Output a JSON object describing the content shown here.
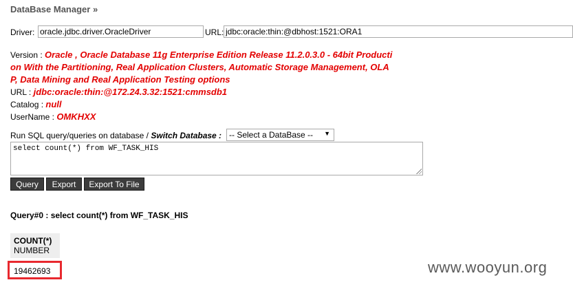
{
  "header": {
    "title": "DataBase Manager »"
  },
  "connection": {
    "driver_label": "Driver:",
    "driver_value": "oracle.jdbc.driver.OracleDriver",
    "url_label": "URL:",
    "url_value": "jdbc:oracle:thin:@dbhost:1521:ORA1"
  },
  "info": {
    "version_label": "Version :",
    "version_line1": "Oracle , Oracle Database 11g Enterprise Edition Release 11.2.0.3.0 - 64bit Producti",
    "version_line2": "on With the Partitioning, Real Application Clusters, Automatic Storage Management, OLA",
    "version_line3": "P, Data Mining and Real Application Testing options",
    "url_label": "URL :",
    "url_value": "jdbc:oracle:thin:@172.24.3.32:1521:cmmsdb1",
    "catalog_label": "Catalog :",
    "catalog_value": "null",
    "username_label": "UserName :",
    "username_value": "OMKHXX"
  },
  "sql": {
    "run_label": "Run SQL query/queries on database / ",
    "switch_label": "Switch Database :",
    "select_value": "-- Select a DataBase --",
    "query_text": "select count(*) from WF_TASK_HIS"
  },
  "buttons": {
    "query": "Query",
    "export": "Export",
    "export_file": "Export To File"
  },
  "result": {
    "heading": "Query#0 : select count(*) from WF_TASK_HIS",
    "column_name": "COUNT(*)",
    "column_type": "NUMBER",
    "value": "19462693"
  },
  "watermark": "www.wooyun.org",
  "colors": {
    "info_value": "#e30000",
    "highlight_border": "#e8282e",
    "button_bg": "#3c3c3c"
  }
}
